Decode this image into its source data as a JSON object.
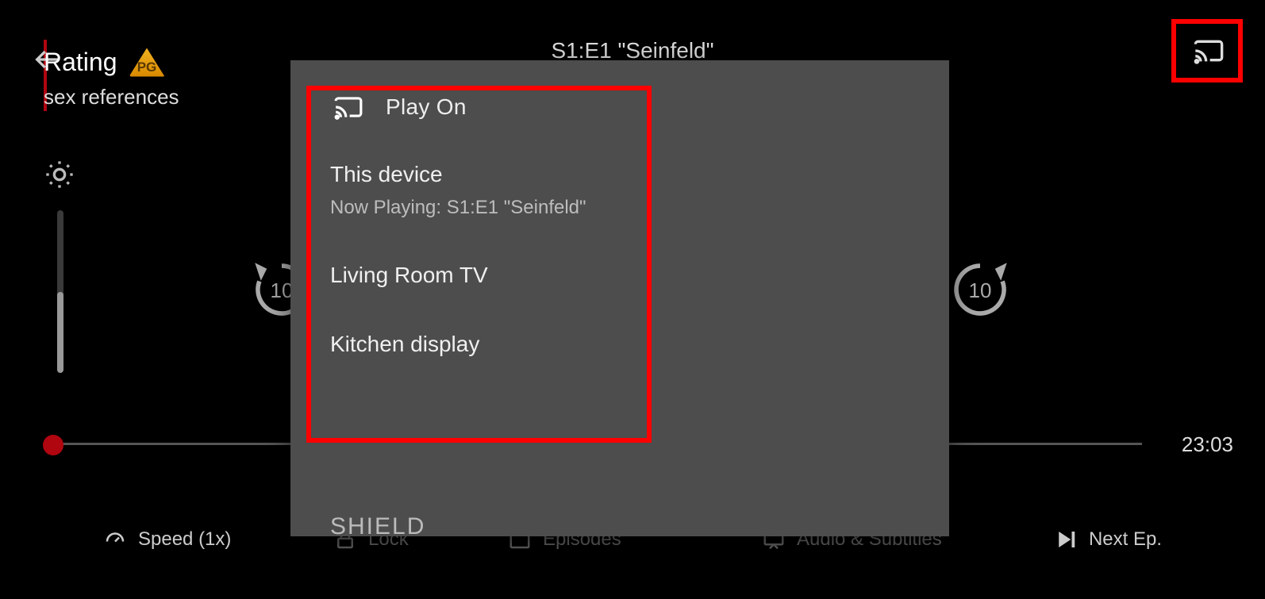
{
  "header": {
    "title": "S1:E1 \"Seinfeld\"",
    "rating_label": "Rating",
    "rating_badge": "PG",
    "rating_sub": "sex references"
  },
  "seek": {
    "back_seconds": "10",
    "fwd_seconds": "10"
  },
  "progress": {
    "time_remaining": "23:03"
  },
  "bottom": {
    "speed": "Speed (1x)",
    "lock": "Lock",
    "episodes": "Episodes",
    "audio": "Audio & Subtitles",
    "next": "Next Ep."
  },
  "modal": {
    "title": "Play On",
    "devices": [
      {
        "name": "This device",
        "sub": "Now Playing: S1:E1 \"Seinfeld\""
      },
      {
        "name": "Living Room TV",
        "sub": ""
      },
      {
        "name": "Kitchen display",
        "sub": ""
      }
    ],
    "partial": "SHIELD"
  }
}
